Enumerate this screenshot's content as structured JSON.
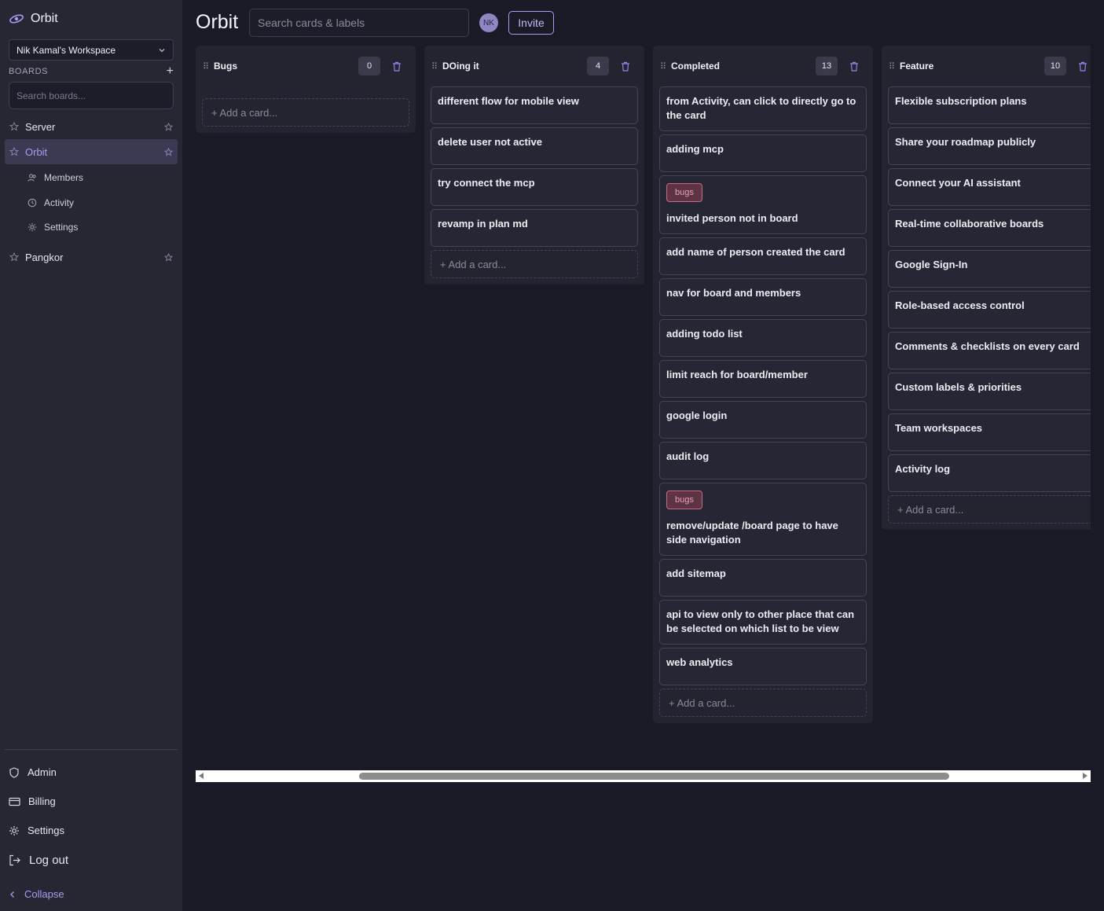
{
  "app": {
    "name": "Orbit"
  },
  "sidebar": {
    "workspace": "Nik Kamal's Workspace",
    "boards_label": "BOARDS",
    "search_placeholder": "Search boards...",
    "boards": [
      {
        "name": "Server"
      },
      {
        "name": "Orbit",
        "active": true,
        "sub": [
          "Members",
          "Activity",
          "Settings"
        ]
      },
      {
        "name": "Pangkor"
      }
    ],
    "footer": [
      "Admin",
      "Billing",
      "Settings",
      "Log out",
      "Collapse"
    ]
  },
  "header": {
    "title": "Orbit",
    "search_placeholder": "Search cards & labels",
    "avatar": "NK",
    "invite": "Invite"
  },
  "lists": [
    {
      "title": "Bugs",
      "count": "0",
      "cards": [],
      "add": "+ Add a card..."
    },
    {
      "title": "DOing it",
      "count": "4",
      "cards": [
        {
          "title": "different flow for mobile view"
        },
        {
          "title": "delete user not active"
        },
        {
          "title": "try connect the mcp"
        },
        {
          "title": "revamp in plan md"
        }
      ],
      "add": "+ Add a card..."
    },
    {
      "title": "Completed",
      "count": "13",
      "cards": [
        {
          "title": "from Activity, can click to directly go to the card"
        },
        {
          "title": "adding mcp"
        },
        {
          "label": "bugs",
          "title": "invited person not in board"
        },
        {
          "title": "add name of person created the card"
        },
        {
          "title": "nav for board and members"
        },
        {
          "title": "adding todo list"
        },
        {
          "title": "limit reach for board/member"
        },
        {
          "title": "google login"
        },
        {
          "title": "audit log"
        },
        {
          "label": "bugs",
          "title": "remove/update /board page to have side navigation"
        },
        {
          "title": "add sitemap"
        },
        {
          "title": "api to view only to other place that can be selected on which list to be view"
        },
        {
          "title": "web analytics"
        }
      ],
      "add": "+ Add a card..."
    },
    {
      "title": "Feature",
      "count": "10",
      "cards": [
        {
          "title": "Flexible subscription plans"
        },
        {
          "title": "Share your roadmap publicly"
        },
        {
          "title": "Connect your AI assistant"
        },
        {
          "title": "Real-time collaborative boards"
        },
        {
          "title": "Google Sign-In"
        },
        {
          "title": "Role-based access control"
        },
        {
          "title": "Comments & checklists on every card"
        },
        {
          "title": "Custom labels & priorities"
        },
        {
          "title": "Team workspaces"
        },
        {
          "title": "Activity log"
        }
      ],
      "add": "+ Add a card..."
    }
  ],
  "colors": {
    "background": "#191a26",
    "sidebar": "#262733",
    "accent": "#a99cf0",
    "label_bugs": "#c6688a"
  }
}
